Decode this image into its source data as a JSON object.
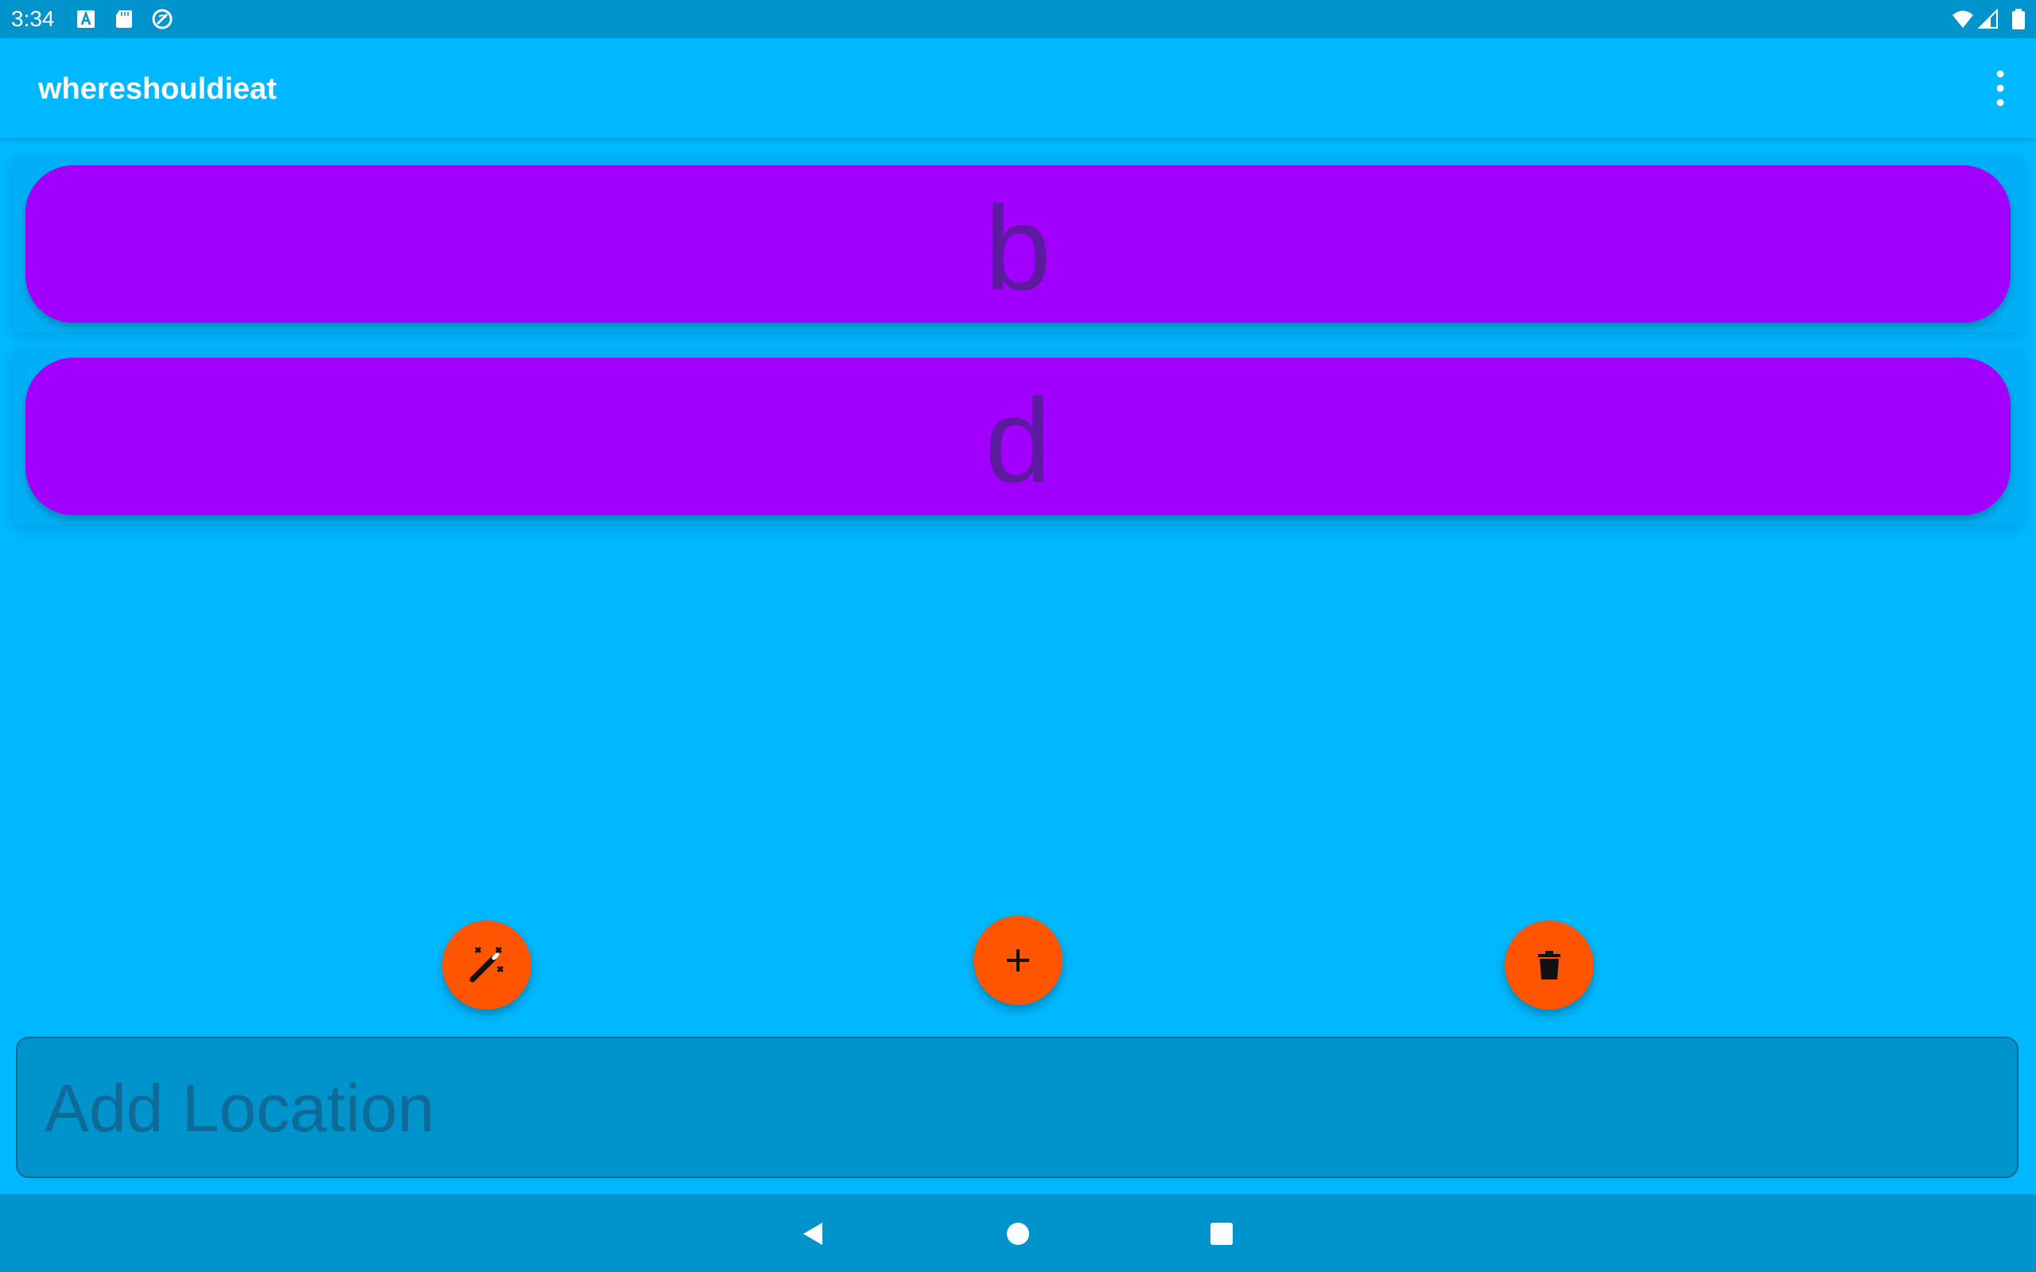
{
  "status_bar": {
    "time": "3:34",
    "left_icons": [
      "a-letter-icon",
      "sd-card-icon",
      "sync-blocked-icon"
    ],
    "right_icons": [
      "wifi-icon",
      "cell-signal-icon",
      "battery-icon"
    ]
  },
  "app_bar": {
    "title": "whereshouldieat",
    "overflow_icon": "more-vert-icon"
  },
  "locations": [
    {
      "label": "b"
    },
    {
      "label": "d"
    }
  ],
  "fabs": {
    "random": {
      "icon": "magic-wand-icon"
    },
    "add": {
      "icon": "plus-icon"
    },
    "delete": {
      "icon": "trash-icon"
    }
  },
  "input": {
    "value": "",
    "placeholder": "Add Location"
  },
  "nav_bar": {
    "icons": [
      "back-triangle-icon",
      "home-circle-icon",
      "recents-square-icon"
    ]
  },
  "colors": {
    "background": "#00B8FF",
    "bar": "#0093CC",
    "item": "#A100FF",
    "item_text": "#5C1A9E",
    "fab": "#FF5500"
  }
}
